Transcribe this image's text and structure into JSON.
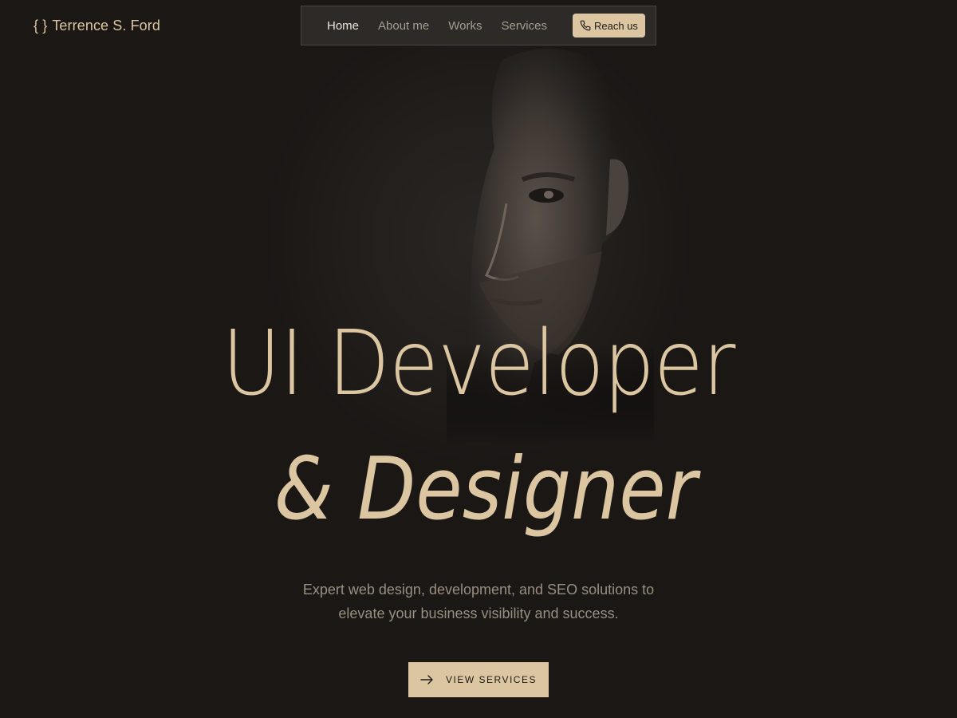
{
  "brand": {
    "braces": "{ }",
    "name": "Terrence S. Ford"
  },
  "nav": {
    "items": [
      {
        "label": "Home",
        "active": true
      },
      {
        "label": "About me",
        "active": false
      },
      {
        "label": "Works",
        "active": false
      },
      {
        "label": "Services",
        "active": false
      }
    ],
    "cta": {
      "label": "Reach us",
      "icon": "phone-icon"
    }
  },
  "hero": {
    "headline_line1": "UI Developer",
    "headline_line2": "& Designer",
    "tagline_line1": "Expert web design, development, and SEO solutions to",
    "tagline_line2": "elevate your business visibility and success.",
    "cta": {
      "label": "VIEW SERVICES",
      "icon": "arrow-right-icon"
    }
  },
  "colors": {
    "background": "#1a1715",
    "accent": "#dcc6a2",
    "nav_bg": "#302d29",
    "muted_text": "#998e80"
  }
}
